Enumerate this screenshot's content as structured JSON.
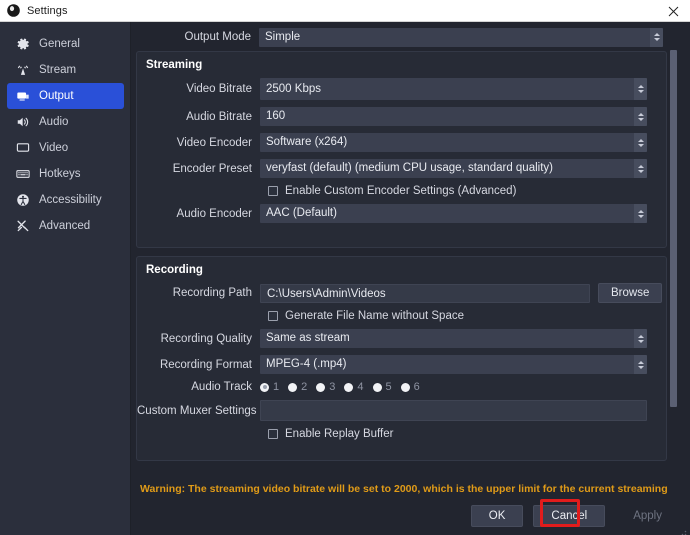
{
  "window": {
    "title": "Settings",
    "logo_icon": "obs-logo-icon",
    "close_icon": "close-icon"
  },
  "sidebar": {
    "items": [
      {
        "label": "General",
        "icon": "gear-icon",
        "active": false
      },
      {
        "label": "Stream",
        "icon": "broadcast-icon",
        "active": false
      },
      {
        "label": "Output",
        "icon": "output-screen-icon",
        "active": true
      },
      {
        "label": "Audio",
        "icon": "speaker-icon",
        "active": false
      },
      {
        "label": "Video",
        "icon": "monitor-icon",
        "active": false
      },
      {
        "label": "Hotkeys",
        "icon": "keyboard-icon",
        "active": false
      },
      {
        "label": "Accessibility",
        "icon": "accessibility-icon",
        "active": false
      },
      {
        "label": "Advanced",
        "icon": "tools-icon",
        "active": false
      }
    ]
  },
  "main": {
    "output_mode": {
      "label": "Output Mode",
      "value": "Simple"
    },
    "streaming": {
      "title": "Streaming",
      "video_bitrate": {
        "label": "Video Bitrate",
        "value": "2500 Kbps"
      },
      "audio_bitrate": {
        "label": "Audio Bitrate",
        "value": "160"
      },
      "video_encoder": {
        "label": "Video Encoder",
        "value": "Software (x264)"
      },
      "encoder_preset": {
        "label": "Encoder Preset",
        "value": "veryfast (default) (medium CPU usage, standard quality)"
      },
      "custom_encoder_checkbox": {
        "label": "Enable Custom Encoder Settings (Advanced)",
        "checked": false
      },
      "audio_encoder": {
        "label": "Audio Encoder",
        "value": "AAC (Default)"
      }
    },
    "recording": {
      "title": "Recording",
      "recording_path": {
        "label": "Recording Path",
        "value": "C:\\Users\\Admin\\Videos",
        "browse_label": "Browse"
      },
      "nospace_checkbox": {
        "label": "Generate File Name without Space",
        "checked": false
      },
      "recording_quality": {
        "label": "Recording Quality",
        "value": "Same as stream"
      },
      "recording_format": {
        "label": "Recording Format",
        "value": "MPEG-4 (.mp4)"
      },
      "audio_track": {
        "label": "Audio Track",
        "options": [
          "1",
          "2",
          "3",
          "4",
          "5",
          "6"
        ],
        "selected": "1"
      },
      "custom_muxer": {
        "label": "Custom Muxer Settings",
        "value": "",
        "placeholder": ""
      },
      "replay_buffer_checkbox": {
        "label": "Enable Replay Buffer",
        "checked": false
      }
    }
  },
  "footer": {
    "warning": "Warning: The streaming video bitrate will be set to 2000, which is the upper limit for the current streaming",
    "ok_label": "OK",
    "cancel_label": "Cancel",
    "apply_label": "Apply",
    "highlight_color": "#e11c1c",
    "warning_color": "#e09b18"
  }
}
